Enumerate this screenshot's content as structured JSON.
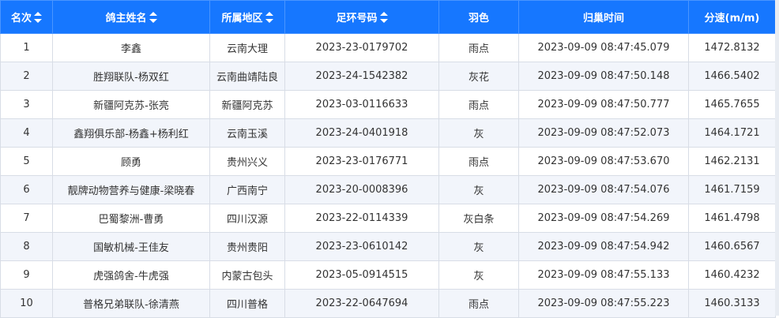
{
  "table": {
    "headers": [
      {
        "label": "名次",
        "sortable": true
      },
      {
        "label": "鸽主姓名",
        "sortable": true
      },
      {
        "label": "所属地区",
        "sortable": true
      },
      {
        "label": "足环号码",
        "sortable": true
      },
      {
        "label": "羽色",
        "sortable": false
      },
      {
        "label": "归巢时间",
        "sortable": false
      },
      {
        "label": "分速(m/m)",
        "sortable": false
      }
    ],
    "rows": [
      [
        "1",
        "李鑫",
        "云南大理",
        "2023-23-0179702",
        "雨点",
        "2023-09-09 08:47:45.079",
        "1472.8132"
      ],
      [
        "2",
        "胜翔联队-杨双红",
        "云南曲靖陆良",
        "2023-24-1542382",
        "灰花",
        "2023-09-09 08:47:50.148",
        "1466.5402"
      ],
      [
        "3",
        "新疆阿克苏-张亮",
        "新疆阿克苏",
        "2023-03-0116633",
        "雨点",
        "2023-09-09 08:47:50.777",
        "1465.7655"
      ],
      [
        "4",
        "鑫翔俱乐部-杨鑫+杨利红",
        "云南玉溪",
        "2023-24-0401918",
        "灰",
        "2023-09-09 08:47:52.073",
        "1464.1721"
      ],
      [
        "5",
        "顾勇",
        "贵州兴义",
        "2023-23-0176771",
        "雨点",
        "2023-09-09 08:47:53.670",
        "1462.2131"
      ],
      [
        "6",
        "靓牌动物营养与健康-梁晓春",
        "广西南宁",
        "2023-20-0008396",
        "灰",
        "2023-09-09 08:47:54.076",
        "1461.7159"
      ],
      [
        "7",
        "巴蜀黎洲-曹勇",
        "四川汉源",
        "2023-22-0114339",
        "灰白条",
        "2023-09-09 08:47:54.269",
        "1461.4798"
      ],
      [
        "8",
        "国敏机械-王佳友",
        "贵州贵阳",
        "2023-23-0610142",
        "灰",
        "2023-09-09 08:47:54.942",
        "1460.6567"
      ],
      [
        "9",
        "虎强鸽舍-牛虎强",
        "内蒙古包头",
        "2023-05-0914515",
        "灰",
        "2023-09-09 08:47:55.133",
        "1460.4232"
      ],
      [
        "10",
        "普格兄弟联队-徐清燕",
        "四川普格",
        "2023-22-0647694",
        "雨点",
        "2023-09-09 08:47:55.223",
        "1460.3133"
      ]
    ]
  },
  "colors": {
    "header_bg": "#1677ff",
    "header_text": "#ffffff",
    "row_alt_bg": "#f2f5fb",
    "border": "#d8dde6"
  }
}
